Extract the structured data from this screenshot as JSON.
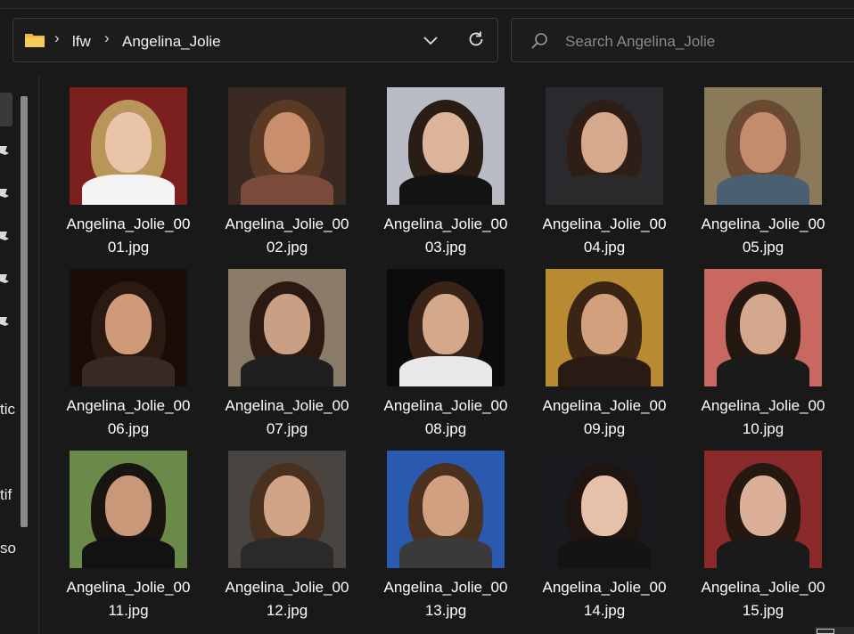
{
  "breadcrumb": [
    "lfw",
    "Angelina_Jolie"
  ],
  "breadcrumb_separator": "›",
  "search": {
    "placeholder": "Search Angelina_Jolie"
  },
  "nav": {
    "partial_labels": [
      "tic",
      "tif",
      "so"
    ]
  },
  "files": [
    {
      "name": "Angelina_Jolie_00\n01.jpg",
      "bg": "#7b1f1f",
      "hair": "#b9955a",
      "face": "#e8c4a8",
      "body": "#f4f4f4"
    },
    {
      "name": "Angelina_Jolie_00\n02.jpg",
      "bg": "#3b2a22",
      "hair": "#5a3a24",
      "face": "#c98e6c",
      "body": "#7c4a3a"
    },
    {
      "name": "Angelina_Jolie_00\n03.jpg",
      "bg": "#b9bcc4",
      "hair": "#2a1d16",
      "face": "#dcb49a",
      "body": "#141414"
    },
    {
      "name": "Angelina_Jolie_00\n04.jpg",
      "bg": "#2a2a2e",
      "hair": "#2d1f18",
      "face": "#d6a88c",
      "body": "#2a2a2a"
    },
    {
      "name": "Angelina_Jolie_00\n05.jpg",
      "bg": "#8a7a5a",
      "hair": "#6a4a30",
      "face": "#c48c6c",
      "body": "#4a6070"
    },
    {
      "name": "Angelina_Jolie_00\n06.jpg",
      "bg": "#1a0d08",
      "hair": "#2a1a12",
      "face": "#d09a78",
      "body": "#3a2a24"
    },
    {
      "name": "Angelina_Jolie_00\n07.jpg",
      "bg": "#8a7c68",
      "hair": "#2a1a12",
      "face": "#caa084",
      "body": "#202020"
    },
    {
      "name": "Angelina_Jolie_00\n08.jpg",
      "bg": "#0c0c0c",
      "hair": "#3a2418",
      "face": "#d4a88a",
      "body": "#e8e8e8"
    },
    {
      "name": "Angelina_Jolie_00\n09.jpg",
      "bg": "#b88a32",
      "hair": "#3a2414",
      "face": "#d2a07c",
      "body": "#2a1a14"
    },
    {
      "name": "Angelina_Jolie_00\n10.jpg",
      "bg": "#c86860",
      "hair": "#241810",
      "face": "#d4a88c",
      "body": "#1a1a1a"
    },
    {
      "name": "Angelina_Jolie_00\n11.jpg",
      "bg": "#6a8a4a",
      "hair": "#1a1410",
      "face": "#c89878",
      "body": "#121212"
    },
    {
      "name": "Angelina_Jolie_00\n12.jpg",
      "bg": "#4a4440",
      "hair": "#4a301e",
      "face": "#d2a486",
      "body": "#2a2a2a"
    },
    {
      "name": "Angelina_Jolie_00\n13.jpg",
      "bg": "#2a5ab0",
      "hair": "#4a301e",
      "face": "#d0a080",
      "body": "#3a3a3a"
    },
    {
      "name": "Angelina_Jolie_00\n14.jpg",
      "bg": "#1a1a1e",
      "hair": "#1e1410",
      "face": "#e6c0a8",
      "body": "#141414"
    },
    {
      "name": "Angelina_Jolie_00\n15.jpg",
      "bg": "#8a2a2a",
      "hair": "#241810",
      "face": "#dcb098",
      "body": "#1a1a1a"
    }
  ]
}
